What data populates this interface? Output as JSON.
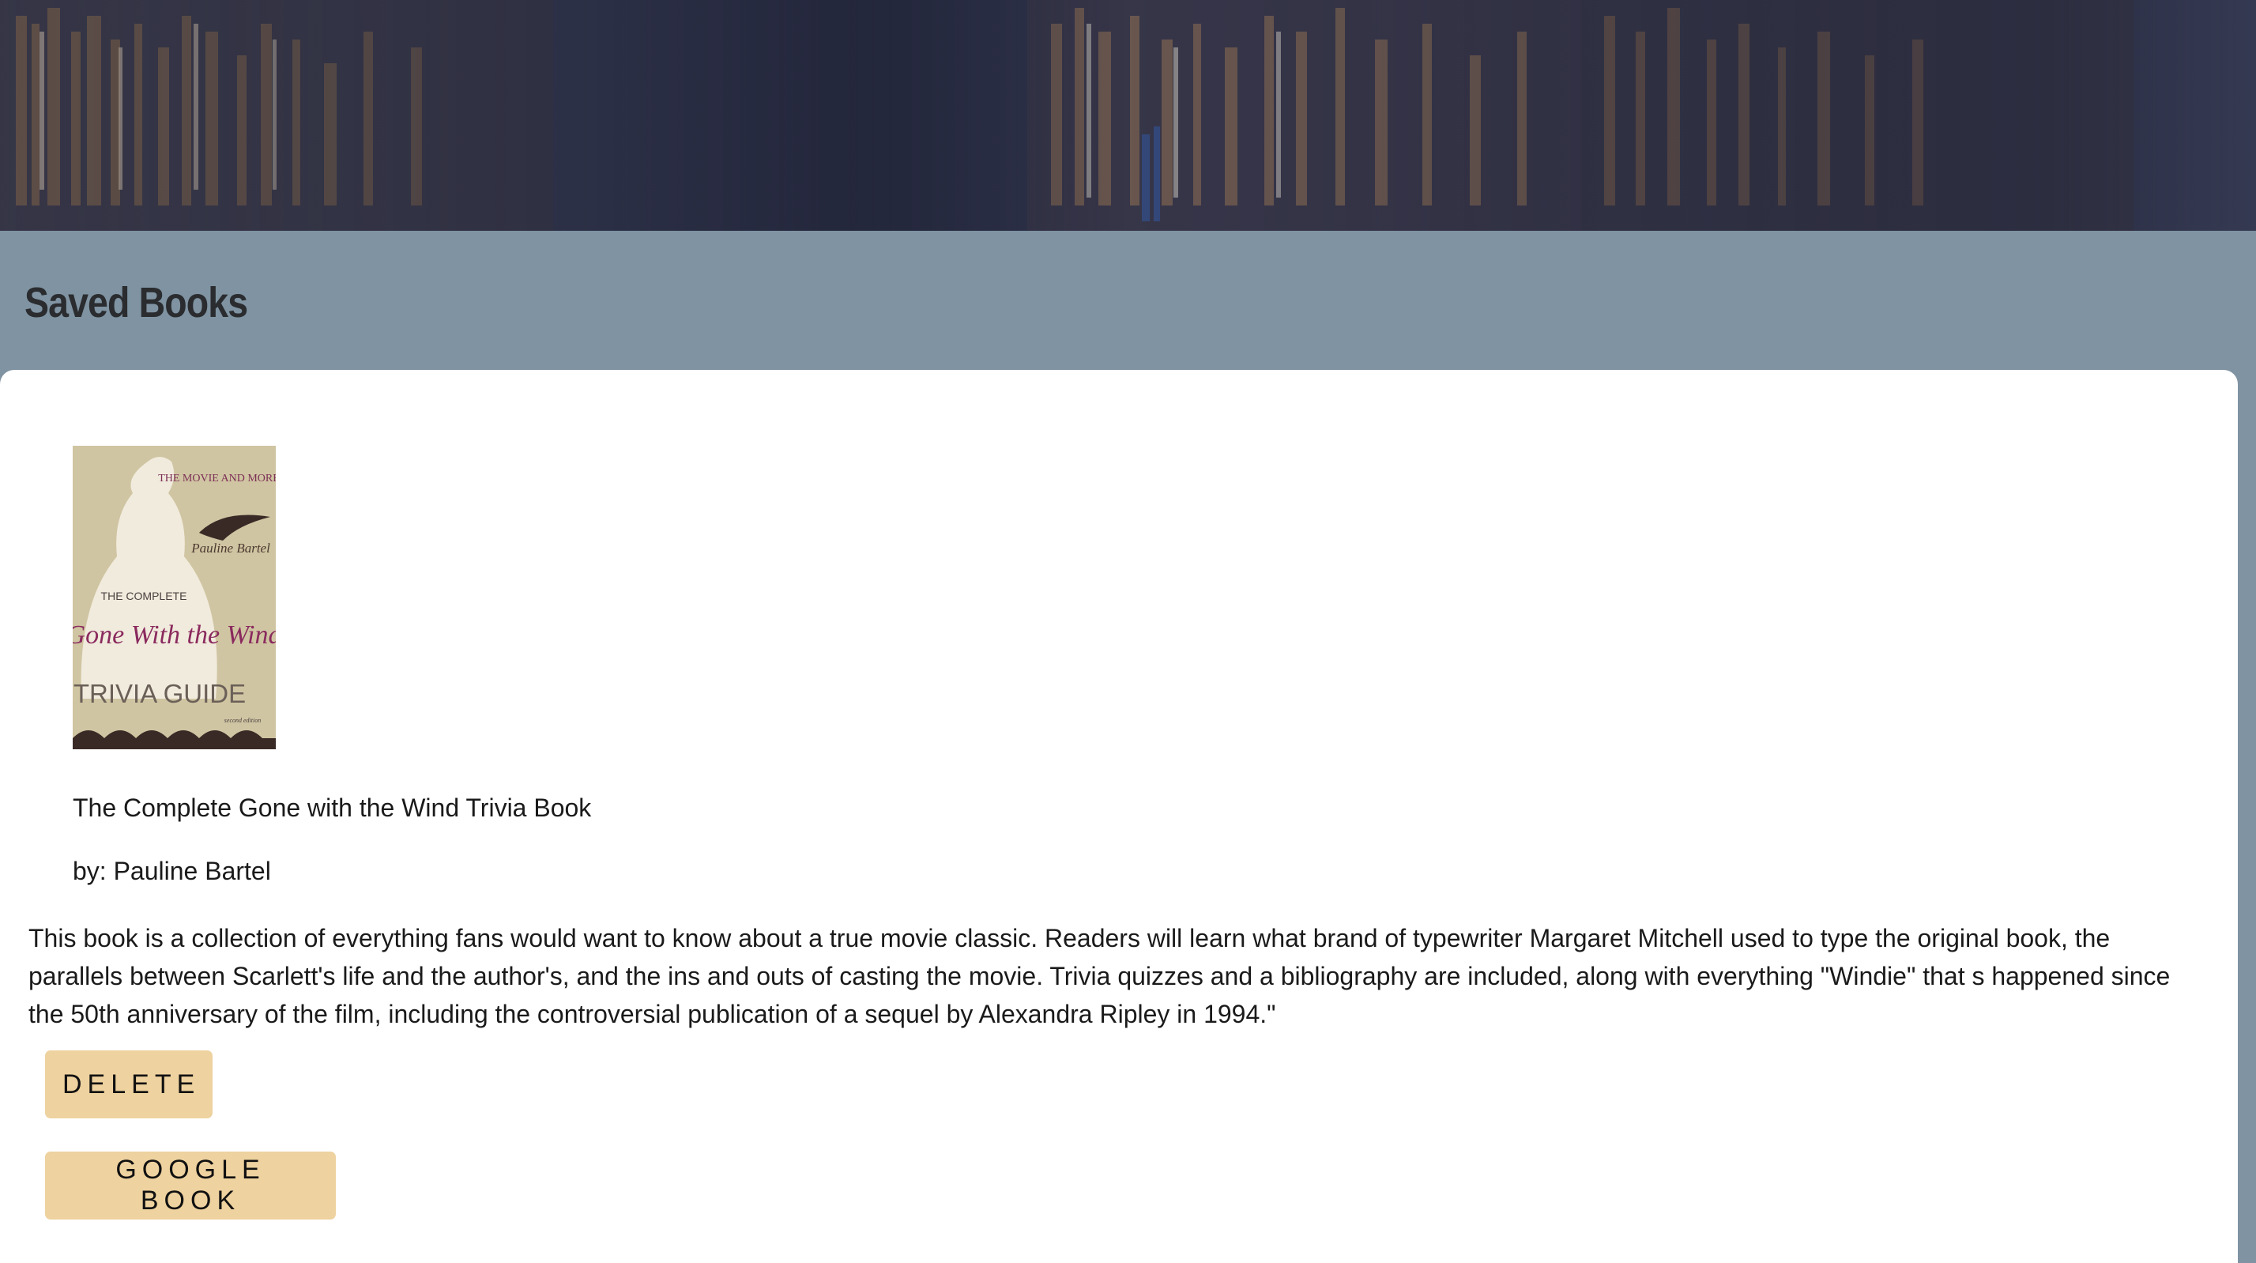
{
  "header": {
    "hero_image": "library-bookshelves-banner",
    "page_title": "Saved Books"
  },
  "book": {
    "cover_image": "gone-with-the-wind-trivia-guide-cover",
    "cover_text": {
      "top": "THE MOVIE AND MORE",
      "author": "Pauline Bartel",
      "pre": "THE COMPLETE",
      "main": "Gone With the Wind",
      "sub": "TRIVIA GUIDE",
      "edition": "second edition"
    },
    "title": "The Complete Gone with the Wind Trivia Book",
    "author": "by: Pauline Bartel",
    "description": "This book is a collection of everything fans would want to know about a true movie classic. Readers will learn what brand of typewriter Margaret Mitchell used to type the original book, the parallels between Scarlett's life and the author's, and the ins and outs of casting the movie. Trivia quizzes and a bibliography are included, along with everything \"Windie\" that s happened since the 50th anniversary of the film, including the controversial publication of a sequel by Alexandra Ripley in 1994.\"",
    "delete_label": "DELETE",
    "google_label": "GOOGLE BOOK"
  },
  "colors": {
    "page_bg": "#7f93a2",
    "card_bg": "#ffffff",
    "button_bg": "#eed29f",
    "title_text": "#2a2c2f"
  }
}
